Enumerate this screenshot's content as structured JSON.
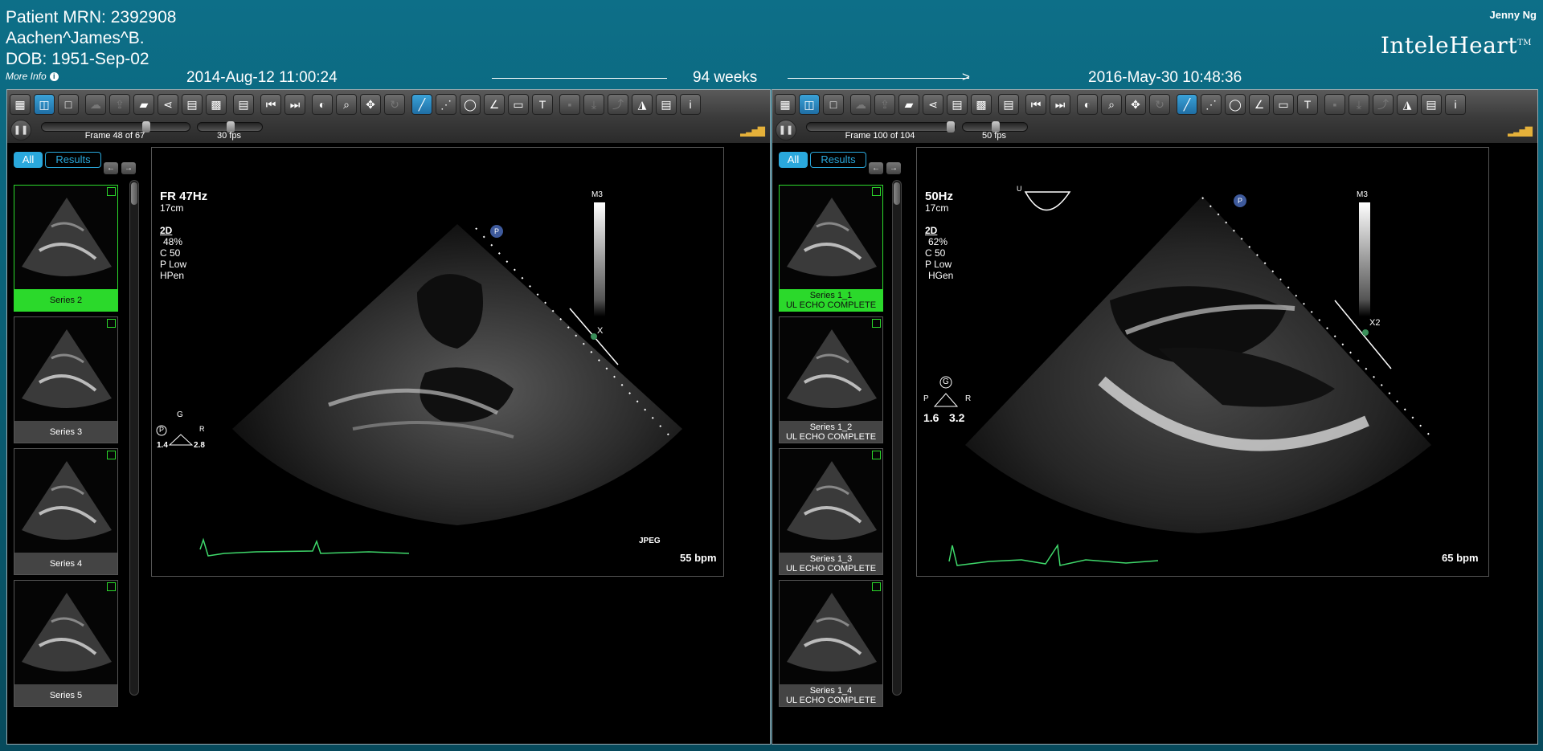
{
  "header": {
    "mrn": "Patient MRN: 2392908",
    "patient_name": "Aachen^James^B.",
    "dob": "DOB: 1951-Sep-02",
    "more_info": "More Info",
    "user": "Jenny Ng",
    "brand": "InteleHeart",
    "trademark": "TM",
    "date_left": "2014-Aug-12 11:00:24",
    "interval": "94 weeks",
    "date_right": "2016-May-30 10:48:36"
  },
  "colors": {
    "header_teal": "#0a5a6f",
    "accent_blue": "#2aa8dc",
    "selected_green": "#2bd92b",
    "ecg_green": "#3fd96b",
    "signal_amber": "#e5b13a"
  },
  "left": {
    "frame_label": "Frame 48 of 67",
    "frame_progress": 0.7,
    "fps_label": "30 fps",
    "fps_level": 0.5,
    "filter_all": "All",
    "filter_results": "Results",
    "thumbnails": [
      {
        "line1": "Series 2",
        "line2": "",
        "selected": true
      },
      {
        "line1": "Series 3",
        "line2": "",
        "selected": false
      },
      {
        "line1": "Series 4",
        "line2": "",
        "selected": false
      },
      {
        "line1": "Series 5",
        "line2": "",
        "selected": false
      }
    ],
    "overlay": {
      "freq": "FR 47Hz",
      "depth": "17cm",
      "mode": "2D",
      "gain": "48%",
      "compress": "C 50",
      "power": "P Low",
      "probe": "HPen",
      "map": "M3",
      "codec": "JPEG",
      "bpm": "55 bpm",
      "marker_g": "G",
      "marker_p": "P",
      "marker_r": "R",
      "val_a": "1.4",
      "val_b": "2.8",
      "probe_badge": "P",
      "caliper_label": "X"
    }
  },
  "right": {
    "frame_label": "Frame 100 of 104",
    "frame_progress": 0.96,
    "fps_label": "50 fps",
    "fps_level": 0.5,
    "filter_all": "All",
    "filter_results": "Results",
    "thumbnails": [
      {
        "line1": "Series 1_1",
        "line2": "UL ECHO COMPLETE",
        "selected": true
      },
      {
        "line1": "Series 1_2",
        "line2": "UL ECHO COMPLETE",
        "selected": false
      },
      {
        "line1": "Series 1_3",
        "line2": "UL ECHO COMPLETE",
        "selected": false
      },
      {
        "line1": "Series 1_4",
        "line2": "UL ECHO COMPLETE",
        "selected": false
      }
    ],
    "overlay": {
      "freq": "50Hz",
      "depth": "17cm",
      "mode": "2D",
      "gain": "62%",
      "compress": "C 50",
      "power": "P Low",
      "probe": "HGen",
      "map": "M3",
      "bpm": "65 bpm",
      "marker_g": "G",
      "marker_p": "P",
      "marker_r": "R",
      "val_a": "1.6",
      "val_b": "3.2",
      "probe_badge": "P",
      "caliper_label": "X2",
      "orient": "U"
    }
  },
  "toolbar_icons": [
    "layout-grid-icon",
    "layout-split-icon",
    "layout-single-icon",
    "cloud-upload-icon",
    "export-icon",
    "folder-icon",
    "share-icon",
    "archive-icon",
    "hanging-protocol-icon",
    "report-icon",
    "first-frame-icon",
    "last-frame-icon",
    "contrast-icon",
    "zoom-icon",
    "pan-icon",
    "rotate-icon",
    "ruler-icon",
    "polyline-icon",
    "ellipse-icon",
    "angle-icon",
    "annotation-box-icon",
    "text-icon",
    "save-icon",
    "download-icon",
    "send-icon",
    "spectral-icon",
    "document-icon",
    "info-icon"
  ]
}
